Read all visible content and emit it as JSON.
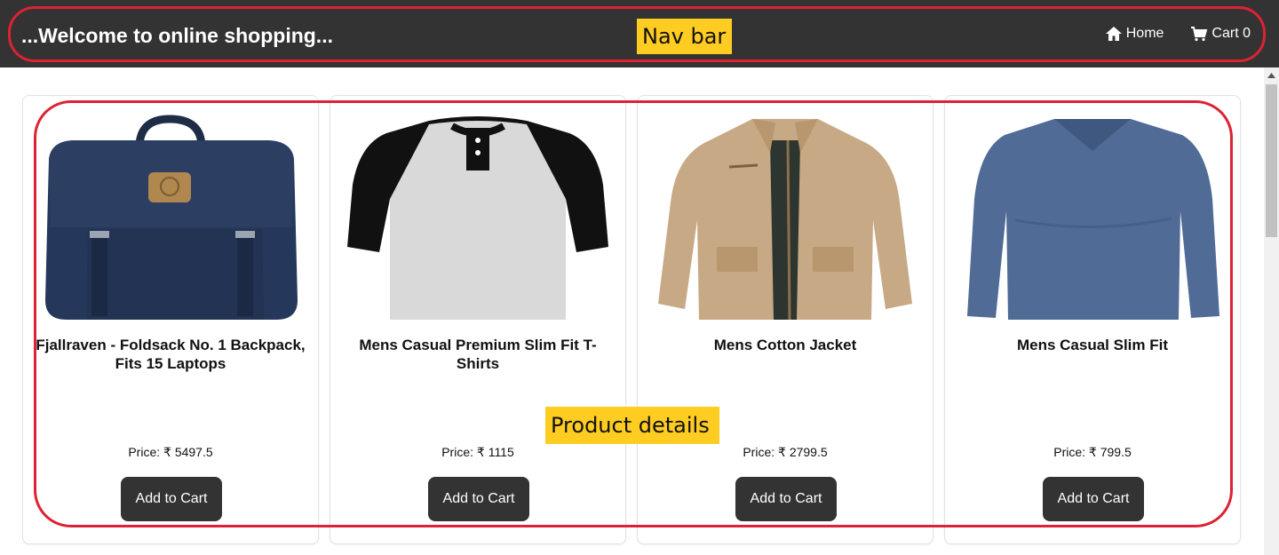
{
  "navbar": {
    "brand": "...Welcome to online shopping...",
    "links": [
      {
        "label": "Home",
        "icon": "home-icon"
      },
      {
        "label": "Cart 0",
        "icon": "cart-icon"
      }
    ]
  },
  "annotations": {
    "nav_label": "Nav bar",
    "products_label": "Product details",
    "outline_color": "#dd2233",
    "label_color": "#ffcc22"
  },
  "products": [
    {
      "title": "Fjallraven - Foldsack No. 1 Backpack, Fits 15 Laptops",
      "price": "Price: ₹ 5497.5",
      "button": "Add to Cart",
      "image": "backpack-image"
    },
    {
      "title": "Mens Casual Premium Slim Fit T-Shirts",
      "price": "Price: ₹ 1115",
      "button": "Add to Cart",
      "image": "raglan-tshirt-image"
    },
    {
      "title": "Mens Cotton Jacket",
      "price": "Price: ₹ 2799.5",
      "button": "Add to Cart",
      "image": "cotton-jacket-image"
    },
    {
      "title": "Mens Casual Slim Fit",
      "price": "Price: ₹ 799.5",
      "button": "Add to Cart",
      "image": "slim-fit-shirt-image"
    }
  ],
  "colors": {
    "navbar_bg": "#333333",
    "button_bg": "#333333"
  }
}
